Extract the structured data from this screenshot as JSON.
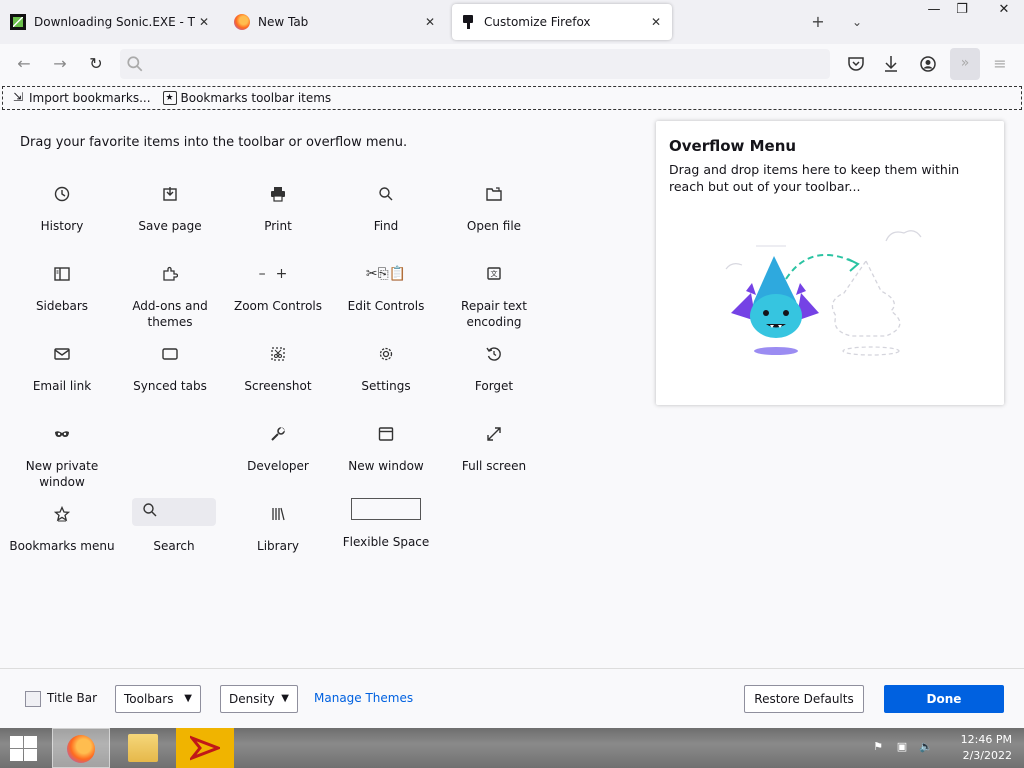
{
  "tabs": [
    {
      "title": "Downloading Sonic.EXE - The G",
      "icon": "sonic-favicon",
      "active": false
    },
    {
      "title": "New Tab",
      "icon": "firefox-favicon",
      "active": false
    },
    {
      "title": "Customize Firefox",
      "icon": "paintbrush-favicon",
      "active": true
    }
  ],
  "bookmarks_toolbar": {
    "import_label": "Import bookmarks...",
    "items_label": "Bookmarks toolbar items"
  },
  "palette": {
    "heading": "Drag your favorite items into the toolbar or overflow menu.",
    "items": [
      {
        "label": "History",
        "icon": "clock-icon"
      },
      {
        "label": "Save page",
        "icon": "save-page-icon"
      },
      {
        "label": "Print",
        "icon": "printer-icon"
      },
      {
        "label": "Find",
        "icon": "magnifier-icon"
      },
      {
        "label": "Open file",
        "icon": "open-file-icon"
      },
      {
        "label": "Sidebars",
        "icon": "sidebar-icon"
      },
      {
        "label": "Add-ons and themes",
        "icon": "puzzle-icon"
      },
      {
        "label": "Zoom Controls",
        "icon": "zoom-controls-icon"
      },
      {
        "label": "Edit Controls",
        "icon": "edit-controls-icon"
      },
      {
        "label": "Repair text encoding",
        "icon": "text-encoding-icon"
      },
      {
        "label": "Email link",
        "icon": "envelope-icon"
      },
      {
        "label": "Synced tabs",
        "icon": "synced-tabs-icon"
      },
      {
        "label": "Screenshot",
        "icon": "screenshot-icon"
      },
      {
        "label": "Settings",
        "icon": "gear-icon"
      },
      {
        "label": "Forget",
        "icon": "forget-icon"
      },
      {
        "label": "New private window",
        "icon": "mask-icon"
      },
      {
        "label": "Developer",
        "icon": "wrench-icon"
      },
      {
        "label": "New window",
        "icon": "window-icon"
      },
      {
        "label": "Full screen",
        "icon": "fullscreen-icon"
      },
      {
        "label": "Bookmarks menu",
        "icon": "star-icon"
      },
      {
        "label": "Search",
        "icon": "search-icon"
      },
      {
        "label": "Library",
        "icon": "library-icon"
      },
      {
        "label": "Flexible Space",
        "icon": "flexible-space-icon"
      }
    ]
  },
  "overflow_menu": {
    "title": "Overflow Menu",
    "description": "Drag and drop items here to keep them within reach but out of your toolbar..."
  },
  "footer": {
    "title_bar_label": "Title Bar",
    "title_bar_checked": false,
    "toolbars_label": "Toolbars",
    "density_label": "Density",
    "manage_themes_label": "Manage Themes",
    "restore_defaults_label": "Restore Defaults",
    "done_label": "Done"
  },
  "taskbar": {
    "time": "12:46 PM",
    "date": "2/3/2022"
  },
  "colors": {
    "accent": "#0061e0",
    "background": "#f9f9fb",
    "tabstrip": "#f0f0f4"
  }
}
